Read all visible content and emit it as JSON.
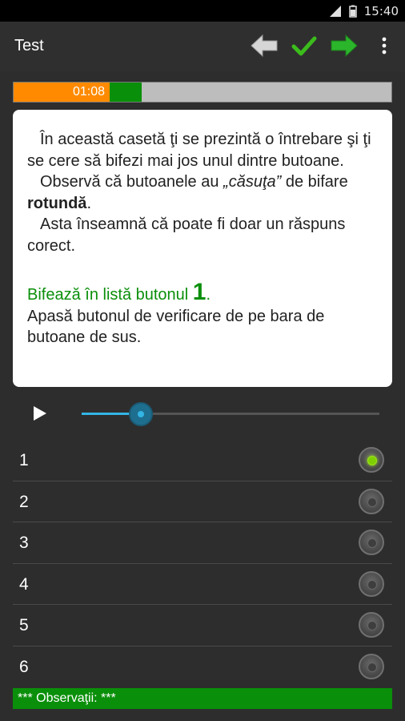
{
  "status_bar": {
    "time": "15:40",
    "icons": [
      "signal-icon",
      "battery-icon"
    ]
  },
  "action_bar": {
    "title": "Test",
    "actions": [
      {
        "name": "back-arrow-icon",
        "color": "#cfcfcf"
      },
      {
        "name": "check-icon",
        "color": "#3cbc1c"
      },
      {
        "name": "forward-arrow-icon",
        "color": "#2bb52b"
      },
      {
        "name": "overflow-menu-icon",
        "color": "#ffffff"
      }
    ]
  },
  "timer": {
    "elapsed": "01:08",
    "progress_fraction": 0.34
  },
  "question": {
    "line1": "În această casetă ţi se prezintă o întrebare şi ţi se cere să bifezi mai jos unul dintre butoane.",
    "line2_prefix": "Observă că butoanele au ",
    "line2_italic": "„căsuţa”",
    "line2_mid": " de bifare ",
    "line2_bold": "rotundă",
    "line2_suffix": ".",
    "line3": "Asta înseamnă că poate fi doar un răspuns corect.",
    "instruction_prefix": "Bifează în listă butonul ",
    "instruction_number": "1",
    "instruction_suffix": ".",
    "hint": "Apasă butonul de verificare de pe bara de butoane de sus."
  },
  "player": {
    "progress_fraction": 0.2
  },
  "options": [
    {
      "label": "1",
      "checked": true
    },
    {
      "label": "2",
      "checked": false
    },
    {
      "label": "3",
      "checked": false
    },
    {
      "label": "4",
      "checked": false
    },
    {
      "label": "5",
      "checked": false
    },
    {
      "label": "6",
      "checked": false
    }
  ],
  "footer": {
    "text": "*** Observaţii: ***"
  },
  "colors": {
    "accent_green": "#0a8f0a",
    "timer_orange": "#ff8a00",
    "slider_blue": "#33b5e5",
    "radio_checked": "#7fd000"
  }
}
